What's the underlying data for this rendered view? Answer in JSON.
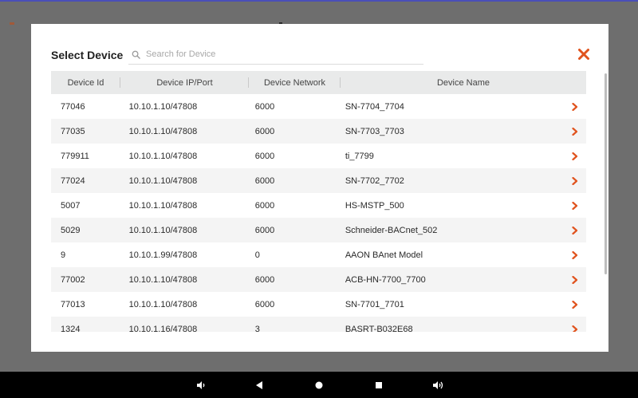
{
  "modal": {
    "title": "Select Device",
    "search_placeholder": "Search for Device",
    "search_value": ""
  },
  "table": {
    "headers": [
      "Device Id",
      "Device IP/Port",
      "Device Network",
      "Device Name"
    ],
    "rows": [
      {
        "id": "77046",
        "ip": "10.10.1.10/47808",
        "network": "6000",
        "name": "SN-7704_7704"
      },
      {
        "id": "77035",
        "ip": "10.10.1.10/47808",
        "network": "6000",
        "name": "SN-7703_7703"
      },
      {
        "id": "779911",
        "ip": "10.10.1.10/47808",
        "network": "6000",
        "name": "ti_7799"
      },
      {
        "id": "77024",
        "ip": "10.10.1.10/47808",
        "network": "6000",
        "name": "SN-7702_7702"
      },
      {
        "id": "5007",
        "ip": "10.10.1.10/47808",
        "network": "6000",
        "name": "HS-MSTP_500"
      },
      {
        "id": "5029",
        "ip": "10.10.1.10/47808",
        "network": "6000",
        "name": "Schneider-BACnet_502"
      },
      {
        "id": "9",
        "ip": "10.10.1.99/47808",
        "network": "0",
        "name": "AAON BAnet Model"
      },
      {
        "id": "77002",
        "ip": "10.10.1.10/47808",
        "network": "6000",
        "name": "ACB-HN-7700_7700"
      },
      {
        "id": "77013",
        "ip": "10.10.1.10/47808",
        "network": "6000",
        "name": "SN-7701_7701"
      },
      {
        "id": "1324",
        "ip": "10.10.1.16/47808",
        "network": "3",
        "name": "BASRT-B032E68"
      }
    ]
  },
  "icons": {
    "search": "search-icon",
    "close": "close-icon",
    "row_action": "chevron-right-icon",
    "nav": [
      "volume-down-icon",
      "back-icon",
      "home-icon",
      "recents-icon",
      "volume-up-icon"
    ]
  },
  "colors": {
    "accent": "#e0531e",
    "header_bg": "#e9eaea",
    "row_alt": "#f4f4f4",
    "backdrop": "#6e6e6e",
    "navbar": "#000000"
  }
}
